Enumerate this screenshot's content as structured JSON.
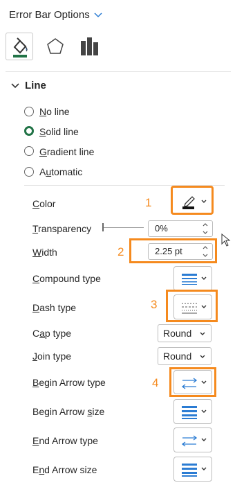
{
  "header": {
    "title": "Error Bar Options"
  },
  "tabs": [
    {
      "name": "fill-line-icon",
      "active": true
    },
    {
      "name": "effects-icon",
      "active": false
    },
    {
      "name": "bar-options-icon",
      "active": false
    }
  ],
  "section": {
    "title": "Line"
  },
  "line_type": {
    "options": [
      {
        "label_u": "N",
        "label_rest": "o line"
      },
      {
        "label_u": "S",
        "label_rest": "olid line"
      },
      {
        "label_u": "G",
        "label_rest": "radient line"
      },
      {
        "label_pre": "A",
        "label_u": "u",
        "label_rest": "tomatic"
      }
    ],
    "selected": "Solid line"
  },
  "props": {
    "color": {
      "label_u": "C",
      "label_rest": "olor",
      "callout": "1"
    },
    "transparency": {
      "label_u": "T",
      "label_rest": "ransparency",
      "value": "0%",
      "level": 0
    },
    "width": {
      "label_u": "W",
      "label_rest": "idth",
      "value": "2.25 pt",
      "callout": "2"
    },
    "compound": {
      "label_u": "C",
      "label_rest": "ompound type"
    },
    "dash": {
      "label_u": "D",
      "label_rest": "ash type",
      "callout": "3"
    },
    "cap": {
      "label_pre": "C",
      "label_u": "a",
      "label_rest": "p type",
      "value": "Round"
    },
    "join": {
      "label_u": "J",
      "label_rest": "oin type",
      "value": "Round"
    },
    "begin_arrow_type": {
      "label_u": "B",
      "label_rest": "egin Arrow type",
      "callout": "4"
    },
    "begin_arrow_size": {
      "label_pre": "Begin Arrow ",
      "label_u": "s",
      "label_rest": "ize"
    },
    "end_arrow_type": {
      "label_u": "E",
      "label_rest": "nd Arrow type"
    },
    "end_arrow_size": {
      "label_pre": "E",
      "label_u": "n",
      "label_rest": "d Arrow size"
    }
  },
  "colors": {
    "accent": "#217346",
    "highlight": "#f58a1e",
    "icon_blue": "#2b7cd3"
  }
}
